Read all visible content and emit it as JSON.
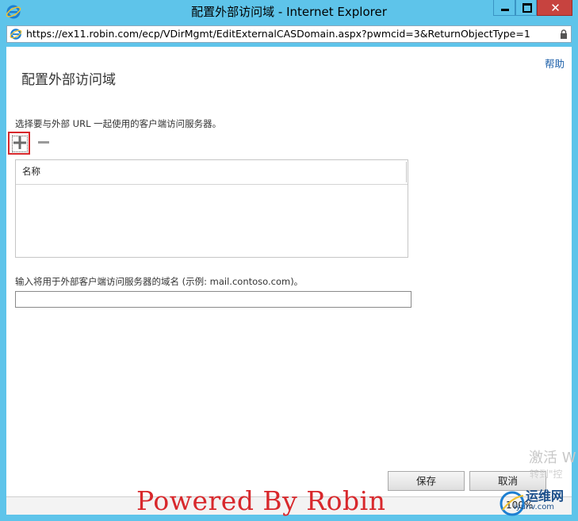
{
  "window": {
    "title": "配置外部访问域 - Internet Explorer",
    "url": "https://ex11.robin.com/ecp/VDirMgmt/EditExternalCASDomain.aspx?pwmcid=3&ReturnObjectType=1",
    "close_glyph": "✕"
  },
  "page": {
    "help_label": "帮助",
    "title": "配置外部访问域",
    "instruction": "选择要与外部 URL 一起使用的客户端访问服务器。",
    "list": {
      "columns": [
        "名称"
      ]
    },
    "domain_label": "输入将用于外部客户端访问服务器的域名 (示例: mail.contoso.com)。",
    "domain_value": "",
    "save_label": "保存",
    "cancel_label": "取消"
  },
  "overlay": {
    "activation_text": "激活 W",
    "activation_sub": "转到\"控",
    "zoom_label": "100%",
    "watermark": "Powered By Robin",
    "site_logo_text": "运维网",
    "site_logo_url": "iyunv.com"
  }
}
